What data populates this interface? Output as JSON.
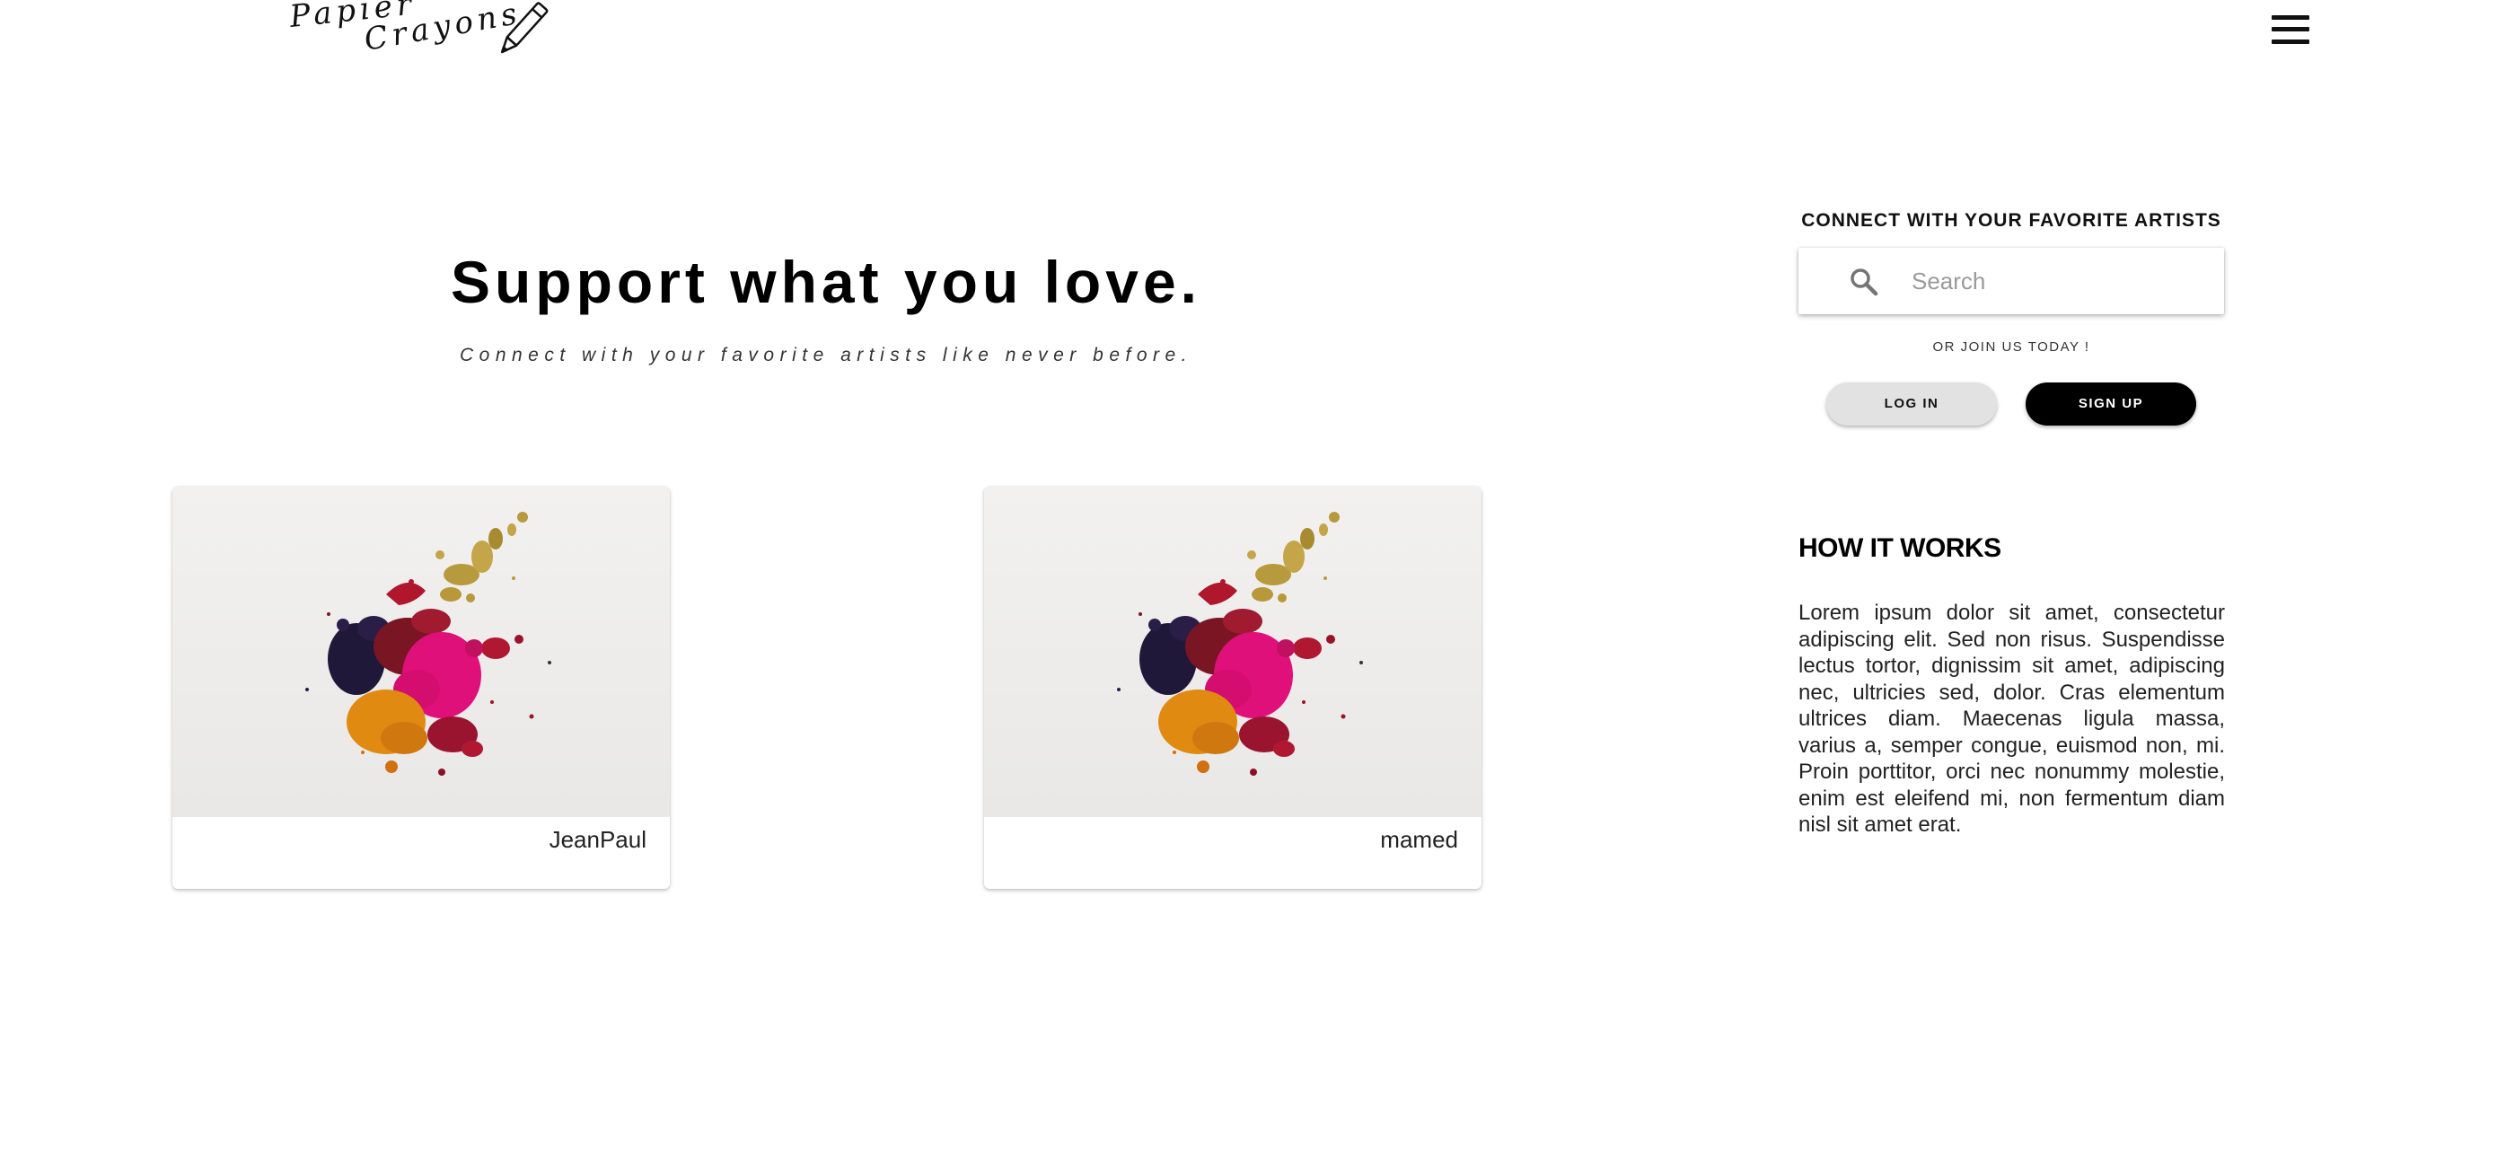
{
  "header": {
    "logo_line1": "Papier",
    "logo_line2": "Crayons",
    "logo_icon": "pencil-icon",
    "menu_icon": "hamburger-menu-icon"
  },
  "hero": {
    "title": "Support what you love.",
    "subtitle": "Connect with your favorite artists like never before."
  },
  "artists": [
    {
      "name": "JeanPaul",
      "image": "paint-splash-image"
    },
    {
      "name": "mamed",
      "image": "paint-splash-image"
    }
  ],
  "sidebar": {
    "connect_title": "CONNECT WITH YOUR FAVORITE ARTISTS",
    "search": {
      "icon": "search-icon",
      "placeholder": "Search",
      "value": ""
    },
    "join_text": "OR JOIN US TODAY !",
    "login_label": "LOG IN",
    "signup_label": "SIGN UP",
    "how_title": "HOW IT WORKS",
    "how_body": "Lorem ipsum dolor sit amet, consectetur adipiscing elit. Sed non risus. Suspendisse lectus tortor, dignissim sit amet, adipiscing nec, ultricies sed, dolor. Cras elementum ultrices diam. Maecenas ligula massa, varius a, semper congue, euismod non, mi. Proin porttitor, orci nec nonummy molestie, enim est eleifend mi, non fermentum diam nisl sit amet erat."
  },
  "colors": {
    "background": "#ffffff",
    "text": "#000000",
    "login_button": "#e2e2e2",
    "signup_button": "#000000"
  }
}
